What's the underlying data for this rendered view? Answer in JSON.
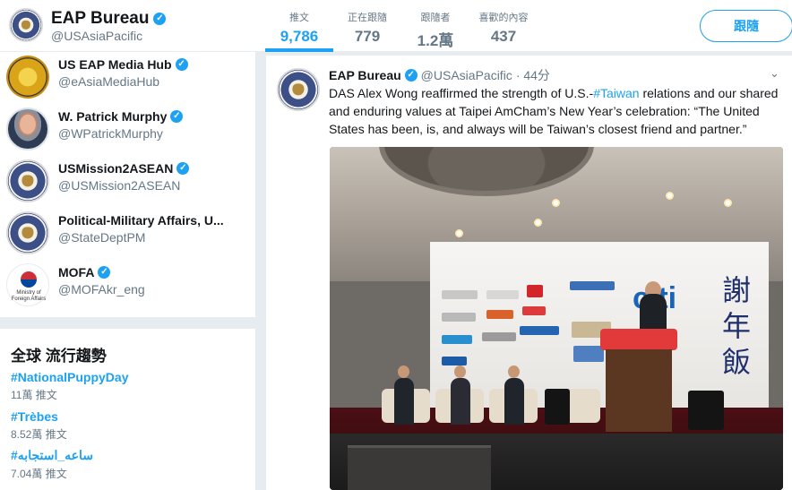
{
  "profile": {
    "name": "EAP Bureau",
    "handle": "@USAsiaPacific",
    "follow_button": "跟隨"
  },
  "stats": [
    {
      "label": "推文",
      "value": "9,786"
    },
    {
      "label": "正在跟隨",
      "value": "779"
    },
    {
      "label": "跟隨者",
      "value": "1.2萬"
    },
    {
      "label": "喜歡的內容",
      "value": "437"
    }
  ],
  "accounts": [
    {
      "name": "US EAP Media Hub",
      "handle": "@eAsiaMediaHub",
      "avatar": "media-hub-seal"
    },
    {
      "name": "W. Patrick Murphy",
      "handle": "@WPatrickMurphy",
      "avatar": "person-photo"
    },
    {
      "name": "USMission2ASEAN",
      "handle": "@USMission2ASEAN",
      "avatar": "state-seal"
    },
    {
      "name": "Political-Military Affairs, U...",
      "handle": "@StateDeptPM",
      "avatar": "state-seal"
    },
    {
      "name": "MOFA",
      "handle": "@MOFAkr_eng",
      "avatar": "mofa-logo",
      "logo_caption": "Ministry of Foreign Affairs"
    }
  ],
  "trends": {
    "title": "全球 流行趨勢",
    "items": [
      {
        "tag": "#NationalPuppyDay",
        "count": "11萬 推文"
      },
      {
        "tag": "#Trèbes",
        "count": "8.52萬 推文"
      },
      {
        "tag": "#ساعه_استجابه",
        "count": "7.04萬 推文"
      }
    ]
  },
  "tweet": {
    "name": "EAP Bureau",
    "handle": "@USAsiaPacific",
    "time": "· 44分",
    "text_before": "DAS Alex Wong reaffirmed the strength of U.S.-",
    "hashtag": "#Taiwan",
    "text_after": " relations and our shared and enduring values at Taipei AmCham’s New Year’s celebration: “The United States has been, is, and always will be Taiwan’s closest friend and partner.”",
    "photo": {
      "banner_brand": "citi",
      "banner_cjk": "謝年飯"
    }
  },
  "icons": {
    "verified": "verified-badge-icon",
    "caret": "chevron-down-icon"
  },
  "colors": {
    "accent": "#1da1f2",
    "muted": "#657786",
    "background": "#e6ecf0"
  }
}
